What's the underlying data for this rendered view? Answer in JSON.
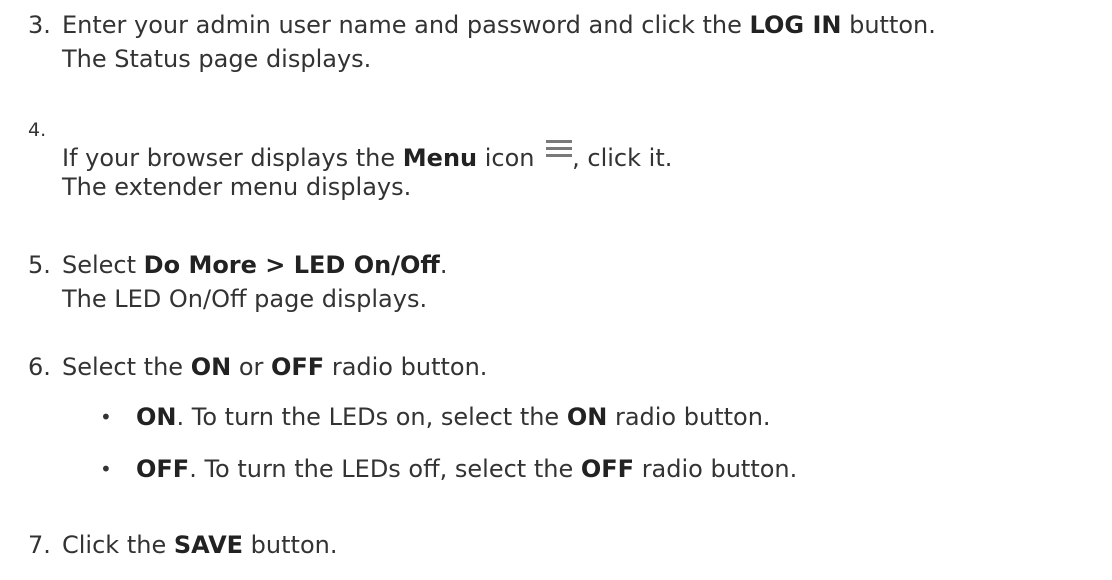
{
  "steps": [
    {
      "number": "3.",
      "line1": {
        "pre": "Enter your admin user name and password and click the ",
        "bold": "LOG IN",
        "post": " button."
      },
      "line2": "The Status page displays."
    },
    {
      "number": "4.",
      "line1": {
        "pre": "If your browser displays the ",
        "bold": "Menu",
        "mid": " icon ",
        "icon": "menu-icon",
        "post": ", click it."
      },
      "line2": "The extender menu displays."
    },
    {
      "number": "5.",
      "line1": {
        "pre": "Select ",
        "bold": "Do More > LED On/Off",
        "post": "."
      },
      "line2": "The LED On/Off page displays."
    },
    {
      "number": "6.",
      "line1": {
        "pre": "Select the ",
        "bold1": "ON",
        "mid": " or ",
        "bold2": "OFF",
        "post": " radio button."
      },
      "bullets": [
        {
          "bold1": "ON",
          "mid": ". To turn the LEDs on, select the ",
          "bold2": "ON",
          "post": " radio button."
        },
        {
          "bold1": "OFF",
          "mid": ". To turn the LEDs off, select the ",
          "bold2": "OFF",
          "post": " radio button."
        }
      ]
    },
    {
      "number": "7.",
      "line1": {
        "pre": "Click the ",
        "bold": "SAVE",
        "post": " button."
      }
    }
  ],
  "bullet_glyph": "•"
}
